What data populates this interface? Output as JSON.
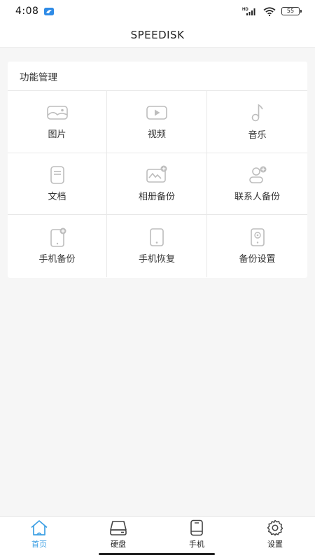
{
  "status_bar": {
    "time": "4:08",
    "network_label": "HD",
    "battery": "55"
  },
  "header": {
    "title": "SPEEDISK"
  },
  "features": {
    "title": "功能管理",
    "items": [
      {
        "label": "图片",
        "icon": "image-icon"
      },
      {
        "label": "视频",
        "icon": "video-icon"
      },
      {
        "label": "音乐",
        "icon": "music-icon"
      },
      {
        "label": "文档",
        "icon": "document-icon"
      },
      {
        "label": "相册备份",
        "icon": "album-backup-icon"
      },
      {
        "label": "联系人备份",
        "icon": "contacts-backup-icon"
      },
      {
        "label": "手机备份",
        "icon": "phone-backup-icon"
      },
      {
        "label": "手机恢复",
        "icon": "phone-restore-icon"
      },
      {
        "label": "备份设置",
        "icon": "backup-settings-icon"
      }
    ]
  },
  "tabbar": {
    "active_color": "#3ea0e4",
    "items": [
      {
        "label": "首页",
        "icon": "home-icon",
        "active": true
      },
      {
        "label": "硬盘",
        "icon": "hard-disk-icon",
        "active": false
      },
      {
        "label": "手机",
        "icon": "phone-icon",
        "active": false
      },
      {
        "label": "设置",
        "icon": "gear-icon",
        "active": false
      }
    ]
  }
}
